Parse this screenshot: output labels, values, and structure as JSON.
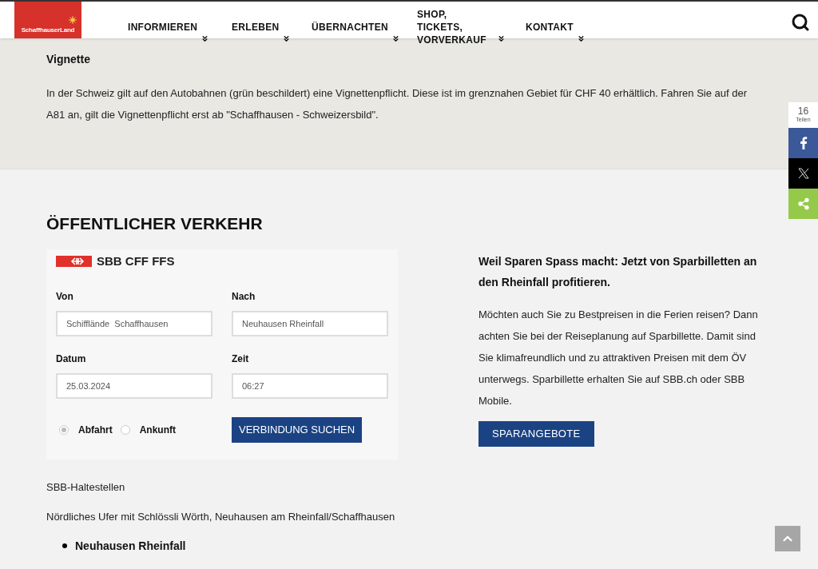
{
  "logo": {
    "text": "SchaffhauserLand"
  },
  "nav": [
    {
      "label": "INFORMIEREN"
    },
    {
      "label": "ERLEBEN"
    },
    {
      "label": "ÜBERNACHTEN"
    },
    {
      "label": "SHOP, TICKETS, VORVERKAUF"
    },
    {
      "label": "KONTAKT"
    }
  ],
  "vignette": {
    "title": "Vignette",
    "text": "In der Schweiz gilt auf den Autobahnen (grün beschildert) eine Vignettenpflicht. Diese ist im grenznahen Gebiet für CHF 40 erhältlich. Fahren Sie auf der A81 an, gilt die Vignettenpflicht erst ab \"Schaffhausen - Schweizersbild\"."
  },
  "share": {
    "count": "16",
    "label": "Teilen",
    "buttons": [
      {
        "kind": "facebook"
      },
      {
        "kind": "x"
      },
      {
        "kind": "share"
      }
    ]
  },
  "section_title": "ÖFFENTLICHER VERKEHR",
  "sbb": {
    "brand": "SBB CFF FFS",
    "fields": [
      {
        "label": "Von",
        "value": "Schifflände  Schaffhausen"
      },
      {
        "label": "Nach",
        "value": "Neuhausen Rheinfall"
      },
      {
        "label": "Datum",
        "value": "25.03.2024"
      },
      {
        "label": "Zeit",
        "value": "06:27"
      }
    ],
    "radios": [
      {
        "label": "Abfahrt",
        "selected": true
      },
      {
        "label": "Ankunft",
        "selected": false
      }
    ],
    "button": "VERBINDUNG SUCHEN"
  },
  "promo": {
    "title": "Weil Sparen Spass macht: Jetzt von Sparbilletten an den Rheinfall profitieren.",
    "text": "Möchten auch Sie zu Bestpreisen in die Ferien reisen? Dann achten Sie bei der Reiseplanung auf Sparbillette. Damit sind Sie klimafreundlich und zu attraktiven Preisen mit dem ÖV unterwegs. Sparbillette erhalten Sie auf SBB.ch oder SBB Mobile.",
    "button": "SPARANGEBOTE"
  },
  "stops": {
    "title": "SBB-Haltestellen",
    "text": "Nördliches Ufer mit Schlössli Wörth, Neuhausen am Rheinfall/Schaffhausen",
    "items": [
      "Neuhausen Rheinfall"
    ]
  }
}
